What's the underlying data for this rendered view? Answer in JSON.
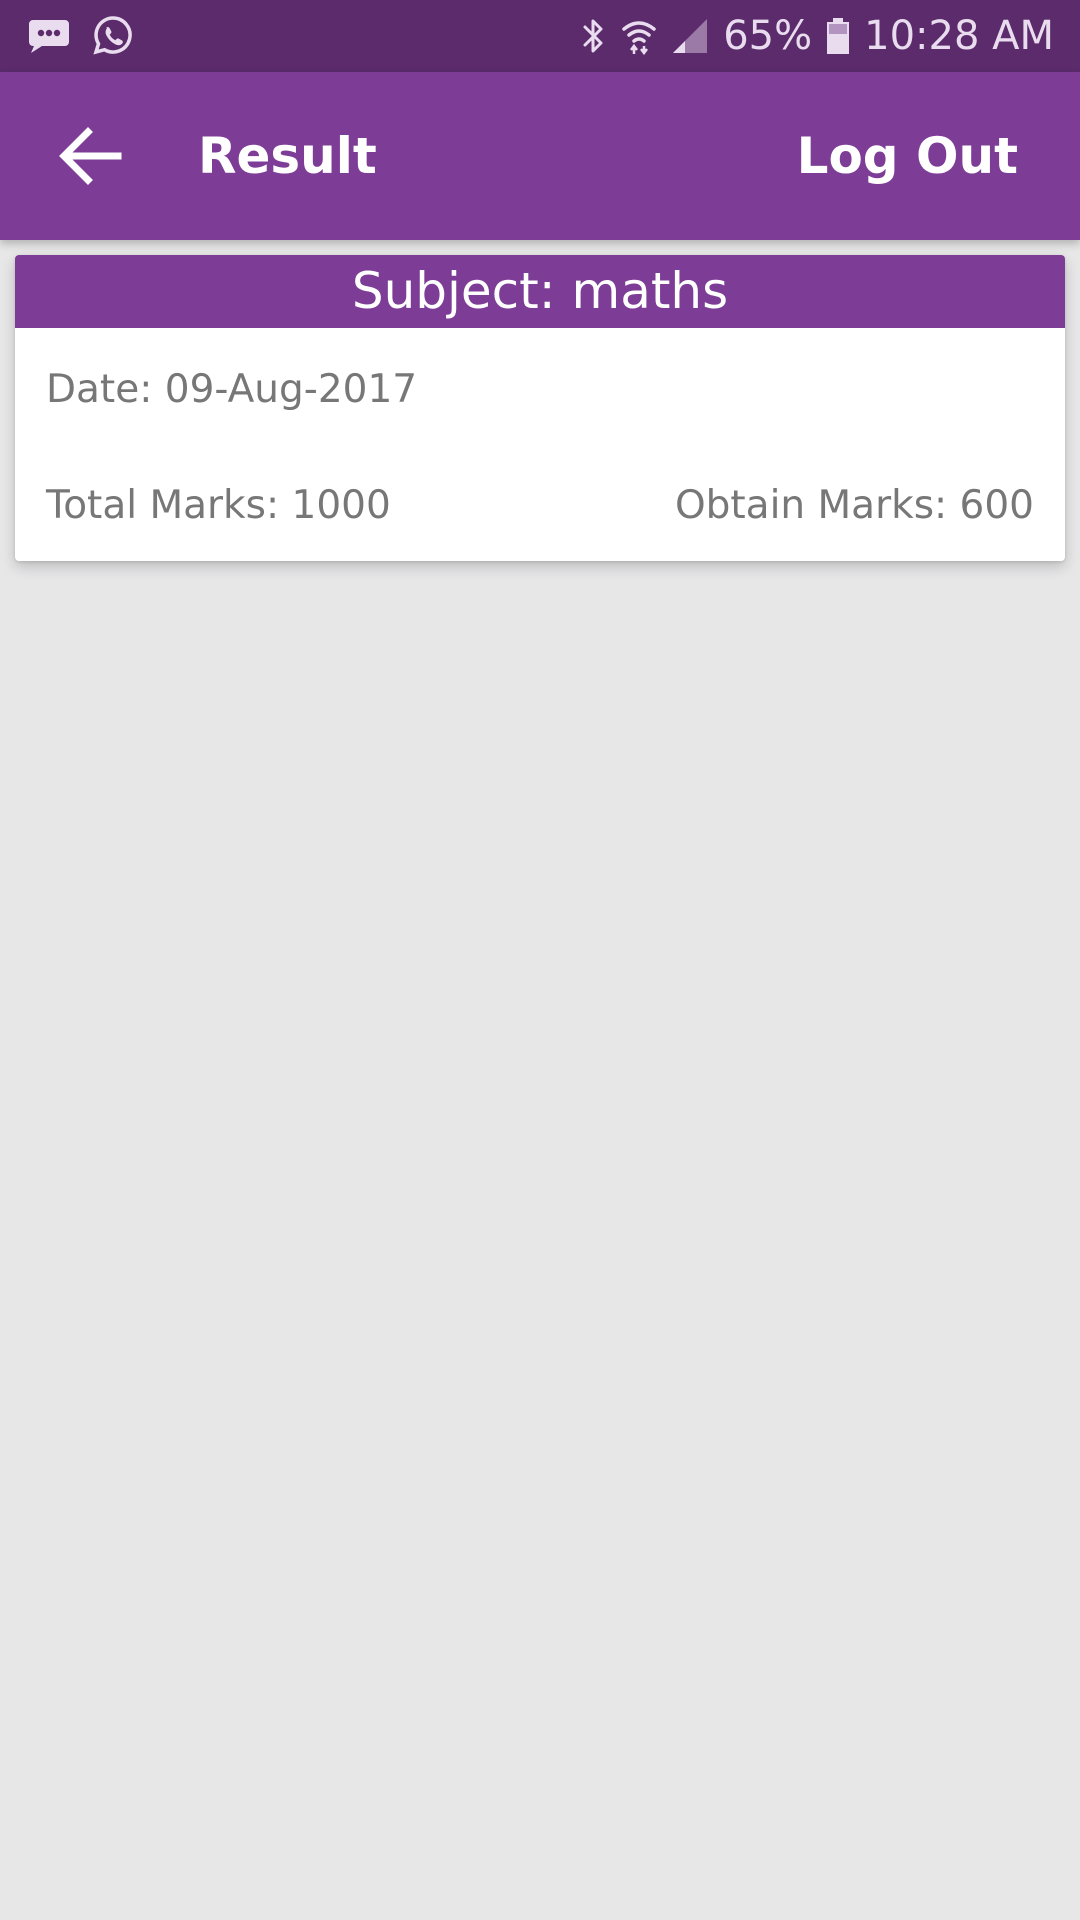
{
  "status_bar": {
    "battery_percent": "65%",
    "time": "10:28 AM",
    "icons": [
      "messages-icon",
      "whatsapp-icon",
      "bluetooth-icon",
      "wifi-icon",
      "cell-signal-icon",
      "battery-icon"
    ]
  },
  "app_bar": {
    "title": "Result",
    "logout_label": "Log Out",
    "back_icon": "arrow-left-icon",
    "background_color": "#7d3c96"
  },
  "result_card": {
    "subject": "Subject: maths",
    "date": "Date: 09-Aug-2017",
    "total_marks": "Total Marks: 1000",
    "obtain_marks": "Obtain Marks: 600"
  },
  "colors": {
    "status_bar": "#5b2b6c",
    "accent": "#7d3c96",
    "background": "#e7e7e8",
    "body_text": "#777777"
  }
}
